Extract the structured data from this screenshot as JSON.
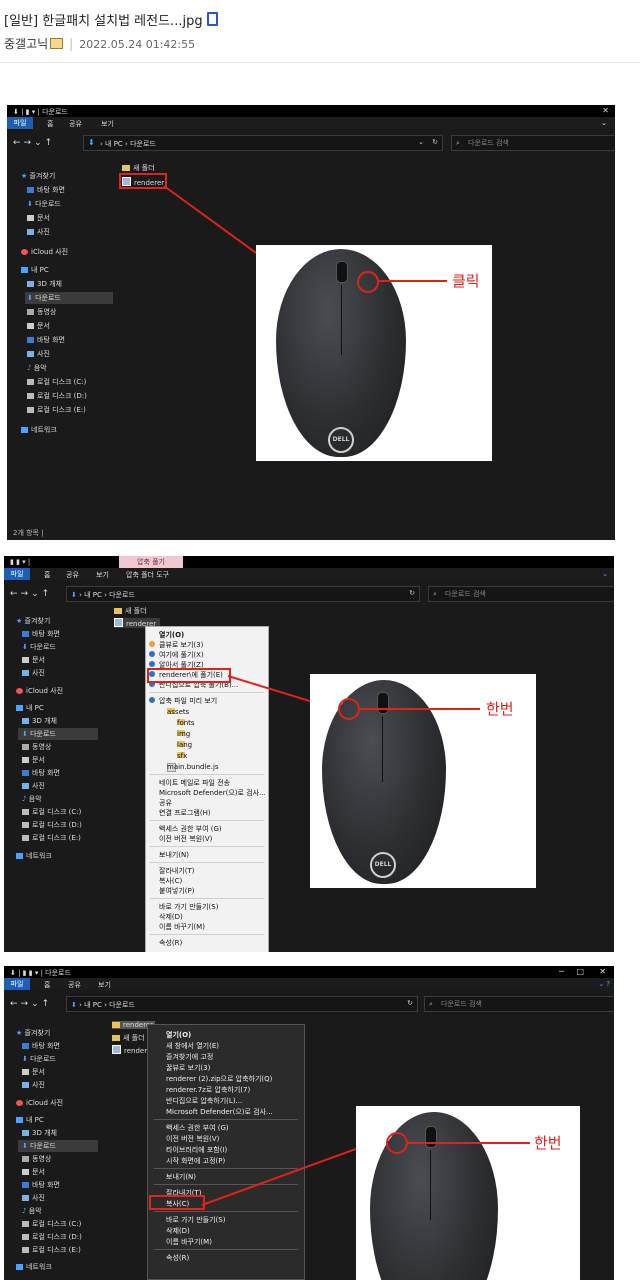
{
  "post": {
    "title": "[일반] 한글패치 설치법 레전드...jpg",
    "author": "중갤고닉",
    "datetime": "2022.05.24 01:42:55"
  },
  "explorer": {
    "folder_title": "다운로드",
    "ribbon": [
      "파일",
      "홈",
      "공유",
      "보기"
    ],
    "extract_tab": "압축 풀기",
    "extract_tools": "압축 폴더 도구",
    "breadcrumb": [
      "내 PC",
      "다운로드"
    ],
    "search_placeholder": "다운로드 검색",
    "nav_items": [
      "즐겨찾기",
      "바탕 화면",
      "다운로드",
      "문서",
      "사진",
      "iCloud 사진",
      "내 PC",
      "3D 개체",
      "다운로드",
      "동영상",
      "문서",
      "바탕 화면",
      "사진",
      "음악",
      "로컬 디스크 (C:)",
      "로컬 디스크 (D:)",
      "로컬 디스크 (E:)",
      "네트워크"
    ],
    "files": [
      "새 폴더",
      "renderer"
    ],
    "status": "2개 항목",
    "icons": [
      "download-arrow-icon",
      "folder-icon",
      "pc-icon",
      "network-icon",
      "search-icon",
      "refresh-icon"
    ]
  },
  "panel1": {
    "annotation": "클릭"
  },
  "panel2": {
    "annotation": "한번",
    "menu": [
      "열기(O)",
      "클뷰로 보기(3)",
      "여기에 풀기(X)",
      "알아서 풀기(Z)",
      "renderer\\에 풀기(E)",
      "반디집으로 압축 풀기(B)...",
      "압축 파일 미리 보기",
      "assets",
      "fonts",
      "img",
      "lang",
      "sfx",
      "main.bundle.js",
      "네이트 메일로 파일 전송",
      "Microsoft Defender(으)로 검사...",
      "공유",
      "연결 프로그램(H)",
      "액세스 권한 부여 (G)",
      "이전 버전 복원(V)",
      "보내기(N)",
      "잘라내기(T)",
      "복사(C)",
      "붙여넣기(P)",
      "바로 가기 만들기(S)",
      "삭제(D)",
      "이름 바꾸기(M)",
      "속성(R)"
    ]
  },
  "panel3": {
    "annotation": "한번",
    "selected": "renderer",
    "other_files": [
      "새 폴더",
      "renderer"
    ],
    "menu": [
      "열기(O)",
      "새 창에서 열기(E)",
      "즐겨찾기에 고정",
      "꿀뷰로 보기(3)",
      "renderer (2).zip으로 압축하기(Q)",
      "renderer.7z로 압축하기(7)",
      "반디집으로 압축하기(L)...",
      "Microsoft Defender(으)로 검사...",
      "액세스 권한 부여 (G)",
      "이전 버전 복원(V)",
      "라이브러리에 포함(I)",
      "시작 화면에 고정(P)",
      "보내기(N)",
      "잘라내기(T)",
      "복사(C)",
      "바로 가기 만들기(S)",
      "삭제(D)",
      "이름 바꾸기(M)",
      "속성(R)"
    ]
  },
  "mouse_brand": "DELL",
  "colors": {
    "annotation_red": "#e0221a",
    "ribbon_blue": "#1d5fb5",
    "explorer_bg": "#1a1a1a"
  }
}
